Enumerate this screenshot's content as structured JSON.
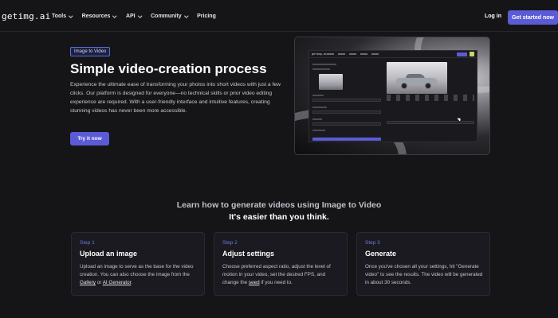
{
  "nav": {
    "logo": "getimg.ai",
    "menu": [
      {
        "label": "Tools",
        "has_dropdown": true
      },
      {
        "label": "Resources",
        "has_dropdown": true
      },
      {
        "label": "API",
        "has_dropdown": true
      },
      {
        "label": "Community",
        "has_dropdown": true
      },
      {
        "label": "Pricing",
        "has_dropdown": false
      }
    ],
    "login": "Log in",
    "cta": "Get started now"
  },
  "hero": {
    "badge": "Image to Video",
    "title": "Simple video-creation process",
    "description": "Experience the ultimate ease of transforming your photos into short videos with just a few clicks. Our platform is designed for everyone—no technical skills or prior video editing experience are required. With a user-friendly interface and intuitive features, creating stunning videos has never been more accessible.",
    "button": "Try it now"
  },
  "section": {
    "title": "Learn how to generate videos using Image to Video",
    "subtitle": "It's easier than you think."
  },
  "steps": [
    {
      "step": "Step 1",
      "title": "Upload an image",
      "desc_pre": "Upload an image to serve as the base for the video creation. You can also choose the image from the ",
      "link1": "Gallery",
      "desc_mid": " or ",
      "link2": "AI Generator",
      "desc_post": "."
    },
    {
      "step": "Step 2",
      "title": "Adjust settings",
      "desc_pre": "Choose preferred aspect ratio, adjust the level of motion in your video, set the desired FPS, and change the ",
      "link1": "seed",
      "desc_post": " if you need to."
    },
    {
      "step": "Step 3",
      "title": "Generate",
      "desc": "Once you've chosen all your settings, hit \"Generate video\" to see the results. The video will be generated in about 30 seconds."
    }
  ],
  "colors": {
    "background": "#151518",
    "accent": "#5b5bd6",
    "step_label": "#6c7ce0"
  }
}
